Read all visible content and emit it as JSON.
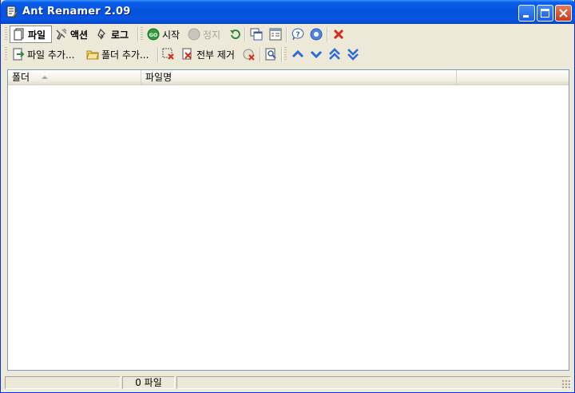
{
  "window": {
    "title": "Ant Renamer 2.09"
  },
  "toolbar_main": {
    "files_label": "파일",
    "actions_label": "액션",
    "log_label": "로그",
    "start_label": "시작",
    "stop_label": "정지"
  },
  "toolbar_files": {
    "add_files_label": "파일 추가...",
    "add_folders_label": "폴더 추가...",
    "remove_all_label": "전부 제거"
  },
  "list": {
    "columns": [
      "폴더",
      "파일명"
    ],
    "sorted_column": "폴더",
    "sort_direction": "ascending"
  },
  "status": {
    "file_count": "0 파일"
  },
  "colors": {
    "titlebar": "#0453DC",
    "window_bg": "#ECE9D8",
    "list_border": "#7F9DB9"
  }
}
